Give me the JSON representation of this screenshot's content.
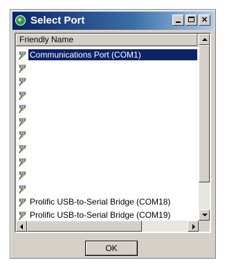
{
  "window": {
    "title": "Select Port",
    "buttons": {
      "minimize": "_",
      "maximize": "□",
      "close": "✕"
    }
  },
  "list": {
    "column_header": "Friendly Name",
    "selected_index": 0,
    "items": [
      "Communications Port (COM1)",
      "",
      "",
      "",
      "",
      "",
      "",
      "",
      "",
      "",
      "",
      "Prolific USB-to-Serial Bridge (COM18)",
      "Prolific USB-to-Serial Bridge (COM19)"
    ],
    "item_icon": "serial-port-icon"
  },
  "footer": {
    "ok_label": "OK"
  },
  "colors": {
    "titlebar": "#0a246a",
    "selection": "#0a246a",
    "face": "#d4d0c8",
    "icon_plug": "#3a6d2a"
  }
}
